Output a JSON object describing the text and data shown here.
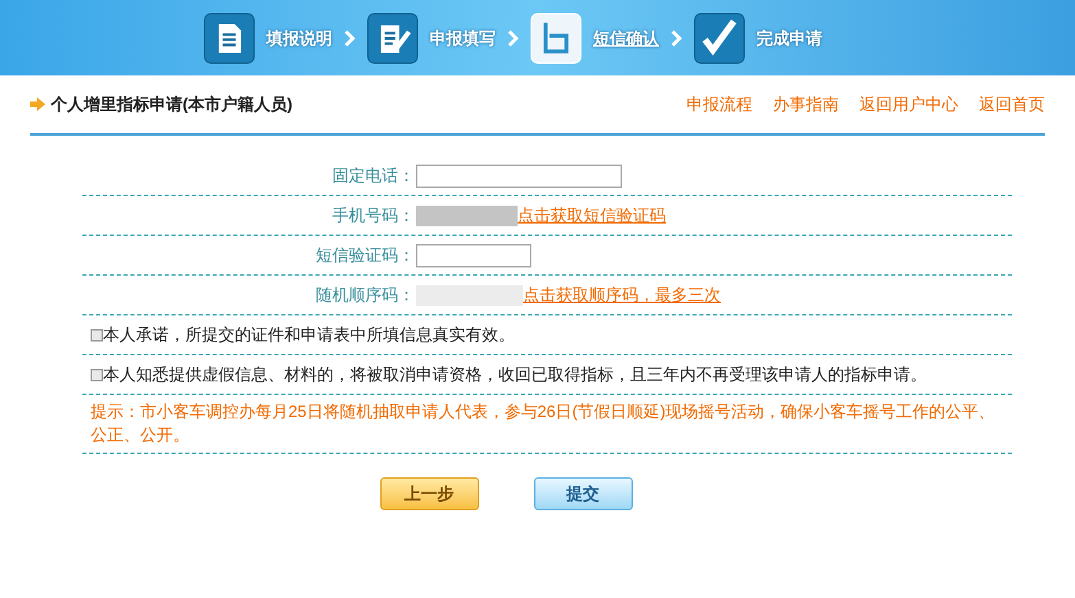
{
  "steps": [
    {
      "label": "填报说明",
      "kind": "document",
      "selected": false
    },
    {
      "label": "申报填写",
      "kind": "edit",
      "selected": false
    },
    {
      "label": "短信确认",
      "kind": "message",
      "selected": true
    },
    {
      "label": "完成申请",
      "kind": "check",
      "selected": false
    }
  ],
  "page_title": "个人增里指标申请(本市户籍人员)",
  "nav_links": [
    "申报流程",
    "办事指南",
    "返回用户中心",
    "返回首页"
  ],
  "form_rows": [
    {
      "label": "固定电话：",
      "kind": "input_wide"
    },
    {
      "label": "手机号码：",
      "kind": "masked",
      "link": "点击获取短信验证码"
    },
    {
      "label": "短信验证码：",
      "kind": "input_narrow"
    },
    {
      "label": "随机顺序码：",
      "kind": "masked_light",
      "link": "点击获取顺序码，最多三次"
    }
  ],
  "agreements": [
    {
      "text": "本人承诺，所提交的证件和申请表中所填信息真实有效。",
      "checked": false
    },
    {
      "text": "本人知悉提供虚假信息、材料的，将被取消申请资格，收回已取得指标，且三年内不再受理该申请人的指标申请。",
      "checked": false
    }
  ],
  "notice": "提示：市小客车调控办每月25日将随机抽取申请人代表，参与26日(节假日顺延)现场摇号活动，确保小客车摇号工作的公平、公正、公开。",
  "buttons": [
    {
      "label": "上一步",
      "kind": "back"
    },
    {
      "label": "提交",
      "kind": "submit"
    }
  ]
}
